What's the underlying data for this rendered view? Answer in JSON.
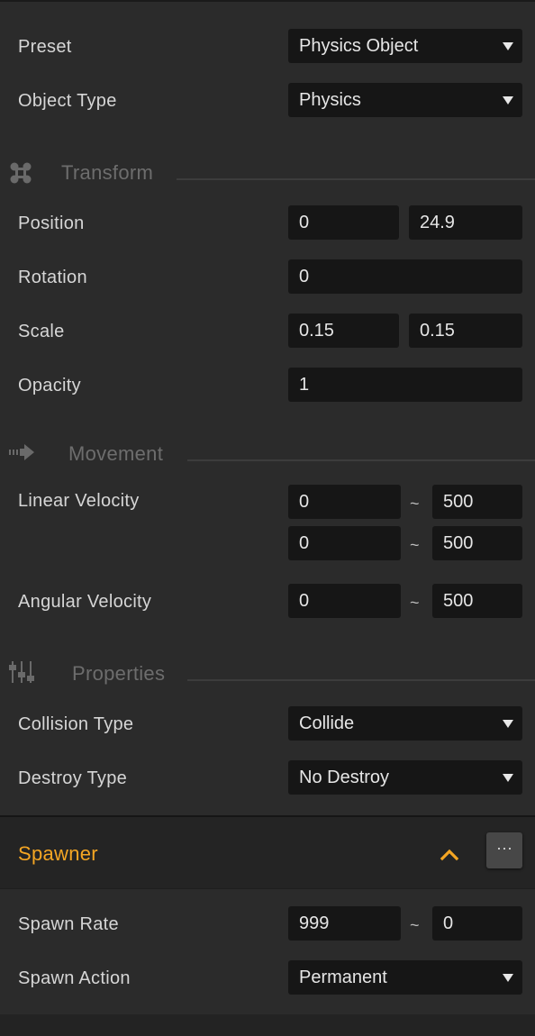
{
  "fields": {
    "preset": {
      "label": "Preset",
      "value": "Physics Object"
    },
    "object_type": {
      "label": "Object Type",
      "value": "Physics"
    }
  },
  "sections": {
    "transform": {
      "title": "Transform",
      "icon": "transform-icon"
    },
    "movement": {
      "title": "Movement",
      "icon": "arrow-right-icon"
    },
    "properties": {
      "title": "Properties",
      "icon": "sliders-icon"
    }
  },
  "transform": {
    "position": {
      "label": "Position",
      "x": "0",
      "y": "24.9"
    },
    "rotation": {
      "label": "Rotation",
      "value": "0"
    },
    "scale": {
      "label": "Scale",
      "x": "0.15",
      "y": "0.15"
    },
    "opacity": {
      "label": "Opacity",
      "value": "1"
    }
  },
  "movement": {
    "linear_velocity": {
      "label": "Linear Velocity",
      "x_min": "0",
      "x_max": "500",
      "y_min": "0",
      "y_max": "500"
    },
    "angular_velocity": {
      "label": "Angular Velocity",
      "min": "0",
      "max": "500"
    },
    "range_separator": "~"
  },
  "properties": {
    "collision_type": {
      "label": "Collision Type",
      "value": "Collide"
    },
    "destroy_type": {
      "label": "Destroy Type",
      "value": "No Destroy"
    }
  },
  "spawner": {
    "title": "Spawner",
    "title_color": "#f5a623",
    "more_label": "···",
    "spawn_rate": {
      "label": "Spawn Rate",
      "min": "999",
      "max": "0"
    },
    "spawn_action": {
      "label": "Spawn Action",
      "value": "Permanent"
    }
  }
}
